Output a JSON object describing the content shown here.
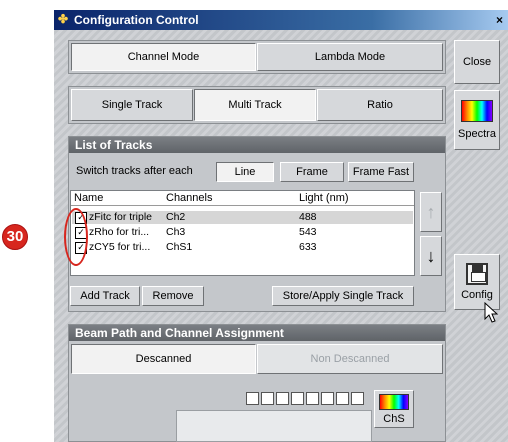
{
  "window": {
    "title": "Configuration Control",
    "close_glyph": "×"
  },
  "mode": {
    "channel": "Channel Mode",
    "lambda": "Lambda Mode"
  },
  "track_modes": {
    "single": "Single Track",
    "multi": "Multi Track",
    "ratio": "Ratio"
  },
  "side": {
    "close": "Close",
    "spectra": "Spectra",
    "config": "Config"
  },
  "tracks": {
    "heading": "List of Tracks",
    "switch_label": "Switch tracks after each",
    "switch_options": [
      "Line",
      "Frame",
      "Frame Fast"
    ],
    "columns": [
      "Name",
      "Channels",
      "Light (nm)"
    ],
    "rows": [
      {
        "name": "Fitc for triple",
        "prefix": "z",
        "channel": "Ch2",
        "light": "488",
        "checked": true
      },
      {
        "name": "Rho for tri...",
        "prefix": "z",
        "channel": "Ch3",
        "light": "543",
        "checked": true
      },
      {
        "name": "CY5 for tri...",
        "prefix": "z",
        "channel": "ChS1",
        "light": "633",
        "checked": true
      }
    ],
    "add": "Add Track",
    "remove": "Remove",
    "store": "Store/Apply Single Track"
  },
  "beam": {
    "heading": "Beam Path and Channel Assignment",
    "descanned": "Descanned",
    "non_descanned": "Non Descanned",
    "chs": "ChS"
  },
  "annotation": {
    "number": "30",
    "color": "#d7261e"
  },
  "icons": [
    "app-icon",
    "close-icon",
    "spectrum-icon",
    "floppy-disk-icon",
    "mouse-cursor-icon",
    "arrow-up-icon",
    "arrow-down-icon",
    "checkbox-icon"
  ]
}
